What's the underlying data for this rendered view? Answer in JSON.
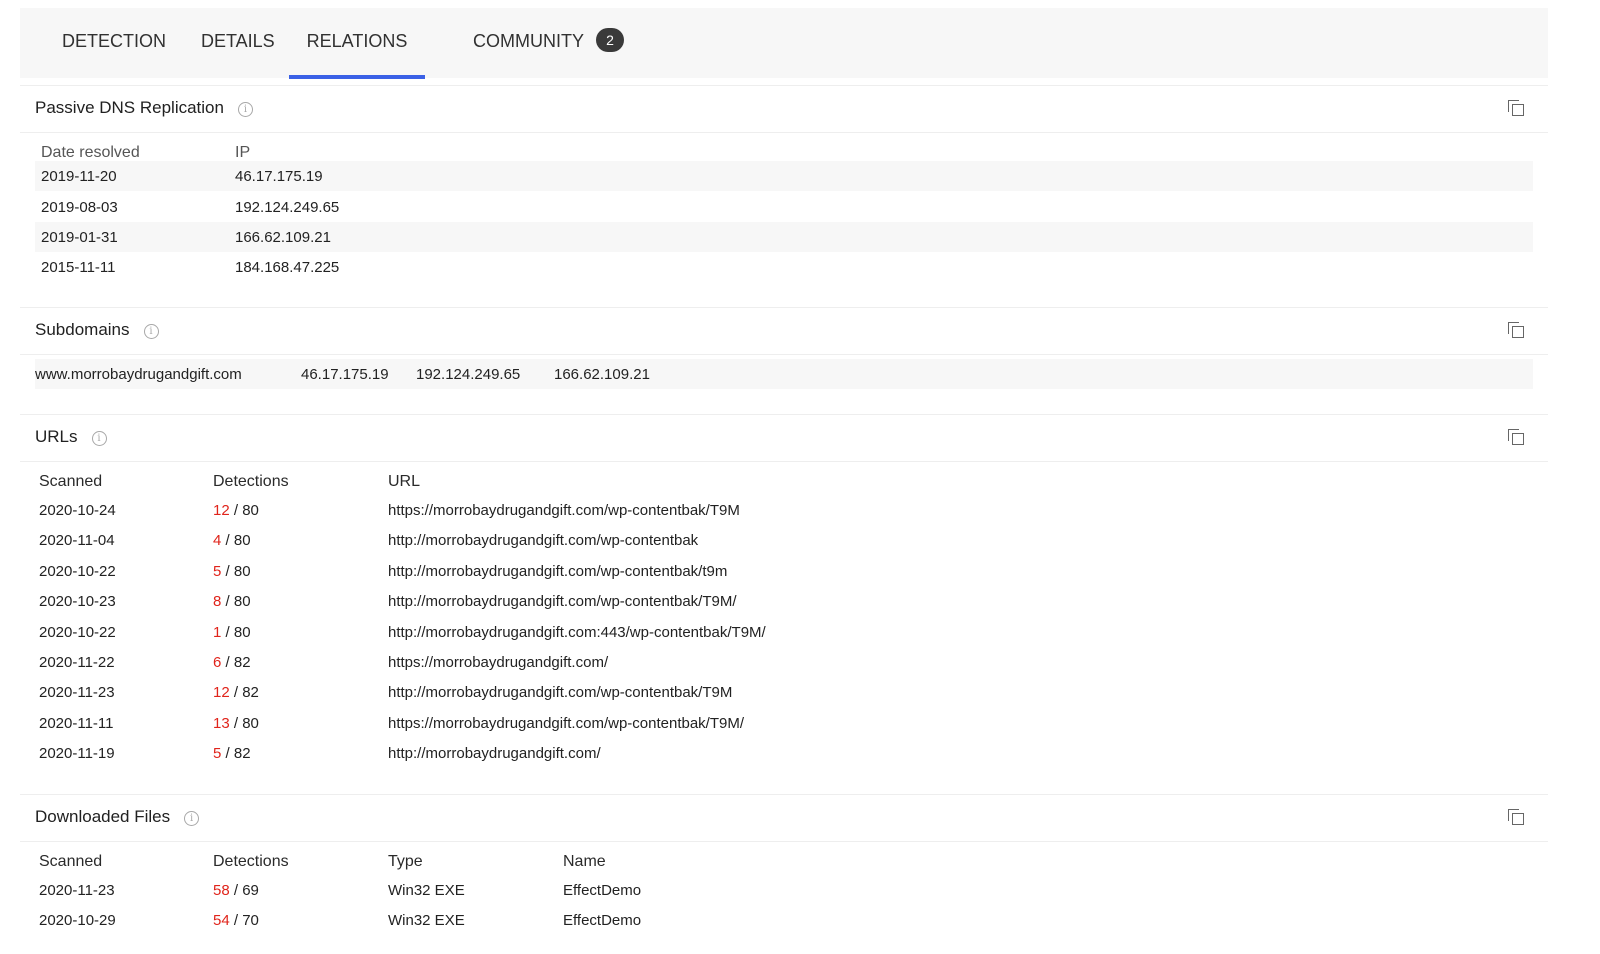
{
  "tabs": [
    {
      "label": "DETECTION"
    },
    {
      "label": "DETAILS"
    },
    {
      "label": "RELATIONS"
    },
    {
      "label": "COMMUNITY",
      "badge": "2"
    }
  ],
  "dns": {
    "title": "Passive DNS Replication",
    "col_date": "Date resolved",
    "col_ip": "IP",
    "rows": [
      {
        "date": "2019-11-20",
        "ip": "46.17.175.19"
      },
      {
        "date": "2019-08-03",
        "ip": "192.124.249.65"
      },
      {
        "date": "2019-01-31",
        "ip": "166.62.109.21"
      },
      {
        "date": "2015-11-11",
        "ip": "184.168.47.225"
      }
    ]
  },
  "subdomains": {
    "title": "Subdomains",
    "row": {
      "domain": "www.morrobaydrugandgift.com",
      "ip1": "46.17.175.19",
      "ip2": "192.124.249.65",
      "ip3": "166.62.109.21"
    }
  },
  "urls": {
    "title": "URLs",
    "col_scanned": "Scanned",
    "col_detections": "Detections",
    "col_url": "URL",
    "rows": [
      {
        "scanned": "2020-10-24",
        "pos": "12",
        "total": "/ 80",
        "url": "https://morrobaydrugandgift.com/wp-contentbak/T9M"
      },
      {
        "scanned": "2020-11-04",
        "pos": "4",
        "total": "/ 80",
        "url": "http://morrobaydrugandgift.com/wp-contentbak"
      },
      {
        "scanned": "2020-10-22",
        "pos": "5",
        "total": "/ 80",
        "url": "http://morrobaydrugandgift.com/wp-contentbak/t9m"
      },
      {
        "scanned": "2020-10-23",
        "pos": "8",
        "total": "/ 80",
        "url": "http://morrobaydrugandgift.com/wp-contentbak/T9M/"
      },
      {
        "scanned": "2020-10-22",
        "pos": "1",
        "total": "/ 80",
        "url": "http://morrobaydrugandgift.com:443/wp-contentbak/T9M/"
      },
      {
        "scanned": "2020-11-22",
        "pos": "6",
        "total": "/ 82",
        "url": "https://morrobaydrugandgift.com/"
      },
      {
        "scanned": "2020-11-23",
        "pos": "12",
        "total": "/ 82",
        "url": "http://morrobaydrugandgift.com/wp-contentbak/T9M"
      },
      {
        "scanned": "2020-11-11",
        "pos": "13",
        "total": "/ 80",
        "url": "https://morrobaydrugandgift.com/wp-contentbak/T9M/"
      },
      {
        "scanned": "2020-11-19",
        "pos": "5",
        "total": "/ 82",
        "url": "http://morrobaydrugandgift.com/"
      }
    ]
  },
  "files": {
    "title": "Downloaded Files",
    "col_scanned": "Scanned",
    "col_detections": "Detections",
    "col_type": "Type",
    "col_name": "Name",
    "rows": [
      {
        "scanned": "2020-11-23",
        "pos": "58",
        "total": "/ 69",
        "type": "Win32 EXE",
        "name": "EffectDemo"
      },
      {
        "scanned": "2020-10-29",
        "pos": "54",
        "total": "/ 70",
        "type": "Win32 EXE",
        "name": "EffectDemo"
      }
    ]
  },
  "colors": {
    "accent": "#3b61e6",
    "detection": "#e0241b",
    "badge": "#3a3a3a"
  }
}
